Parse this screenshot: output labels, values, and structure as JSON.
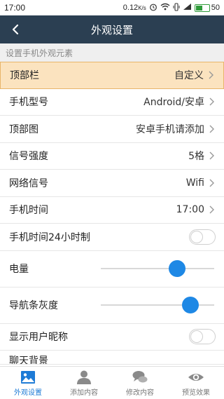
{
  "status": {
    "time": "17:00",
    "speed": "0.12",
    "speed_unit": "K/s",
    "battery": "50",
    "battery_level": 0.5
  },
  "nav": {
    "title": "外观设置"
  },
  "section_header": "设置手机外观元素",
  "rows": [
    {
      "label": "顶部栏",
      "value": "自定义"
    },
    {
      "label": "手机型号",
      "value": "Android/安卓"
    },
    {
      "label": "顶部图",
      "value": "安卓手机请添加"
    },
    {
      "label": "信号强度",
      "value": "5格"
    },
    {
      "label": "网络信号",
      "value": "Wifi"
    },
    {
      "label": "手机时间",
      "value": "17:00"
    }
  ],
  "toggle_rows": [
    {
      "label": "手机时间24小时制",
      "on": false
    },
    {
      "label": "显示用户昵称",
      "on": false
    }
  ],
  "sliders": [
    {
      "label": "电量",
      "level": 0.67
    },
    {
      "label": "导航条灰度",
      "level": 0.79
    }
  ],
  "partial_row": "聊天背景",
  "tabs": [
    {
      "label": "外观设置",
      "icon": "image-icon",
      "active": true
    },
    {
      "label": "添加内容",
      "icon": "person-icon",
      "active": false
    },
    {
      "label": "修改内容",
      "icon": "chat-bubbles-icon",
      "active": false
    },
    {
      "label": "预览效果",
      "icon": "eye-icon",
      "active": false
    }
  ],
  "colors": {
    "nav_bg": "#2b3f52",
    "highlight_bg": "#fbe3bf",
    "accent_blue": "#1e88e5",
    "battery_green": "#2f9b3a"
  }
}
